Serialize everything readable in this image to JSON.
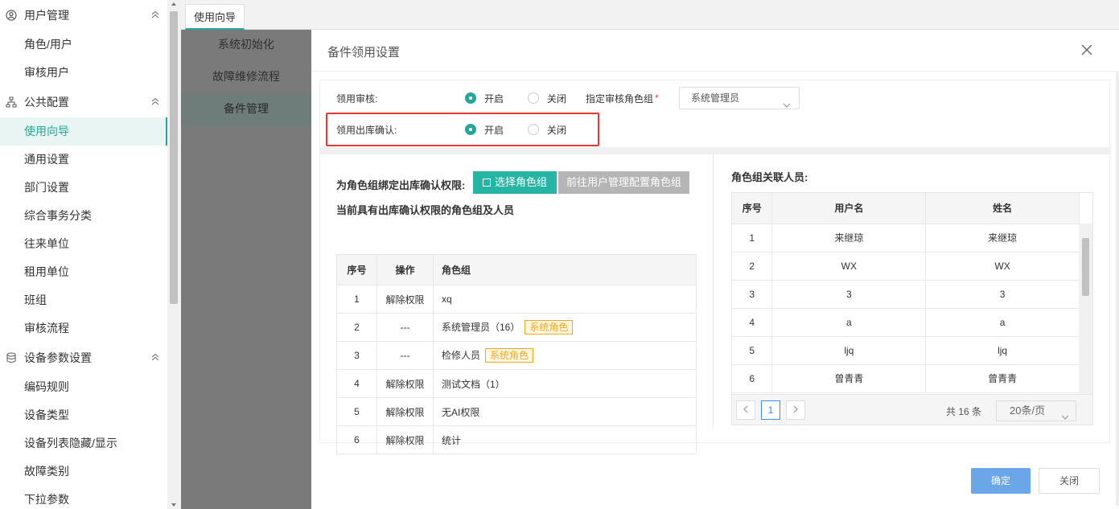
{
  "sidebar": {
    "groups": [
      {
        "label": "用户管理",
        "icon": "user-circle-icon",
        "items": [
          "角色/用户",
          "审核用户"
        ]
      },
      {
        "label": "公共配置",
        "icon": "org-chart-icon",
        "items": [
          "使用向导",
          "通用设置",
          "部门设置",
          "综合事务分类",
          "往来单位",
          "租用单位",
          "班组",
          "审核流程"
        ]
      },
      {
        "label": "设备参数设置",
        "icon": "database-icon",
        "items": [
          "编码规则",
          "设备类型",
          "设备列表隐藏/显示",
          "故障类别",
          "下拉参数"
        ]
      }
    ],
    "active_item": "使用向导"
  },
  "tabbar": {
    "tab": "使用向导"
  },
  "behind_menu": [
    "系统初始化",
    "故障维修流程",
    "备件管理"
  ],
  "modal": {
    "title": "备件领用设置",
    "audit_label": "领用审核:",
    "audit_on": "开启",
    "audit_off": "关闭",
    "role_group_label": "指定审核角色组",
    "required_mark": "*",
    "role_group_value": "系统管理员",
    "outbound_label": "领用出库确认:",
    "outbound_on": "开启",
    "outbound_off": "关闭",
    "bind_label": "为角色组绑定出库确认权限:",
    "select_role_button": "选择角色组",
    "goto_button": "前往用户管理配置角色组",
    "current_label": "当前具有出库确认权限的角色组及人员",
    "left_table": {
      "headers": [
        "序号",
        "操作",
        "角色组"
      ],
      "rows": [
        {
          "no": "1",
          "op": "解除权限",
          "role": "xq",
          "tag": ""
        },
        {
          "no": "2",
          "op": "---",
          "role": "系统管理员（16）",
          "tag": "系统角色"
        },
        {
          "no": "3",
          "op": "---",
          "role": "检修人员",
          "tag": "系统角色"
        },
        {
          "no": "4",
          "op": "解除权限",
          "role": "测试文档（1）",
          "tag": ""
        },
        {
          "no": "5",
          "op": "解除权限",
          "role": "无AI权限",
          "tag": ""
        },
        {
          "no": "6",
          "op": "解除权限",
          "role": "统计",
          "tag": ""
        }
      ]
    },
    "right_label": "角色组关联人员:",
    "right_table": {
      "headers": [
        "序号",
        "用户名",
        "姓名"
      ],
      "rows": [
        [
          "1",
          "来继琼",
          "来继琼"
        ],
        [
          "2",
          "WX",
          "WX"
        ],
        [
          "3",
          "3",
          "3"
        ],
        [
          "4",
          "a",
          "a"
        ],
        [
          "5",
          "ljq",
          "ljq"
        ],
        [
          "6",
          "曾青青",
          "曾青青"
        ]
      ]
    },
    "pager": {
      "current": "1",
      "total": "共 16 条",
      "size": "20条/页"
    },
    "ok_button": "确定",
    "close_button": "关闭"
  }
}
